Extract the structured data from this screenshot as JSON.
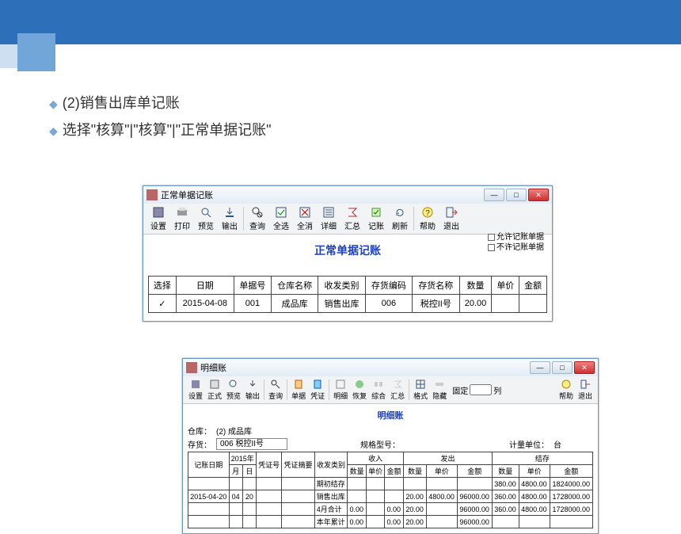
{
  "slide": {
    "line1": "(2)销售出库单记账",
    "line2": "选择\"核算\"|\"核算\"|\"正常单据记账\""
  },
  "win1": {
    "title": "正常单据记账",
    "toolbar": [
      "设置",
      "打印",
      "预览",
      "输出",
      "查询",
      "全选",
      "全消",
      "详细",
      "汇总",
      "记账",
      "刷新",
      "帮助",
      "退出"
    ],
    "heading": "正常单据记账",
    "legend": {
      "allow": "允许记账单据",
      "deny": "不许记账单据"
    },
    "columns": [
      "选择",
      "日期",
      "单据号",
      "仓库名称",
      "收发类别",
      "存货编码",
      "存货名称",
      "数量",
      "单价",
      "金额"
    ],
    "row": {
      "select": "✓",
      "date": "2015-04-08",
      "docno": "001",
      "wh": "成品库",
      "type": "销售出库",
      "code": "006",
      "name": "税控II号",
      "qty": "20.00",
      "price": "",
      "amt": ""
    }
  },
  "win2": {
    "title": "明细账",
    "toolbar": [
      "设置",
      "正式",
      "预览",
      "输出",
      "查询",
      "单据",
      "凭证",
      "明细",
      "恢复",
      "综合",
      "汇总",
      "格式",
      "隐藏"
    ],
    "fixed_label": "固定",
    "col_label": "列",
    "help": "帮助",
    "exit": "退出",
    "heading": "明细账",
    "meta": {
      "wh_label": "仓库：",
      "wh": "(2) 成品库",
      "stock_label": "存货：",
      "stock": "006 税控II号",
      "spec_label": "规格型号：",
      "spec": "",
      "unit_label": "计量单位：",
      "unit": "台"
    },
    "headers": {
      "top": [
        "记账日期",
        "2015年",
        "凭证号",
        "凭证摘要",
        "收发类别",
        "收入",
        "发出",
        "结存"
      ],
      "sub_year": [
        "月",
        "日"
      ],
      "qup": [
        "数量",
        "单价",
        "金额"
      ]
    },
    "rows": [
      {
        "date": "",
        "m": "",
        "d": "",
        "vno": "",
        "vsum": "",
        "type": "期初结存",
        "in_q": "",
        "in_p": "",
        "in_a": "",
        "out_q": "",
        "out_p": "",
        "out_a": "",
        "bal_q": "380.00",
        "bal_p": "4800.00",
        "bal_a": "1824000.00"
      },
      {
        "date": "2015-04-20",
        "m": "04",
        "d": "20",
        "vno": "",
        "vsum": "",
        "type": "销售出库",
        "in_q": "",
        "in_p": "",
        "in_a": "",
        "out_q": "20.00",
        "out_p": "4800.00",
        "out_a": "96000.00",
        "bal_q": "360.00",
        "bal_p": "4800.00",
        "bal_a": "1728000.00"
      },
      {
        "date": "",
        "m": "",
        "d": "",
        "vno": "",
        "vsum": "",
        "type": "4月合计",
        "in_q": "0.00",
        "in_p": "",
        "in_a": "0.00",
        "out_q": "20.00",
        "out_p": "",
        "out_a": "96000.00",
        "bal_q": "360.00",
        "bal_p": "4800.00",
        "bal_a": "1728000.00"
      },
      {
        "date": "",
        "m": "",
        "d": "",
        "vno": "",
        "vsum": "",
        "type": "本年累计",
        "in_q": "0.00",
        "in_p": "",
        "in_a": "0.00",
        "out_q": "20.00",
        "out_p": "",
        "out_a": "96000.00",
        "bal_q": "",
        "bal_p": "",
        "bal_a": ""
      }
    ]
  }
}
